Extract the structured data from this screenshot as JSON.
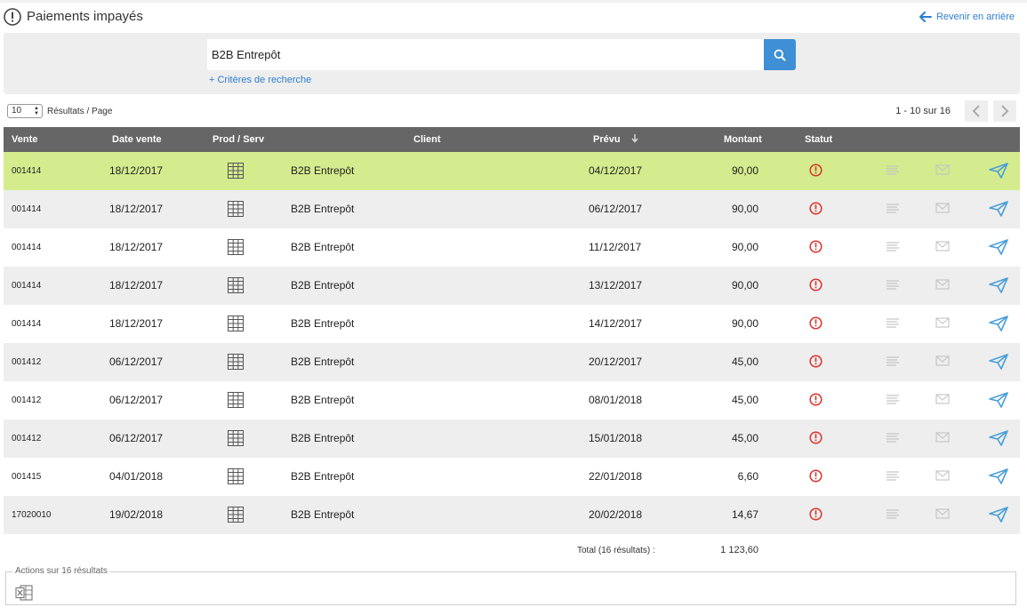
{
  "page": {
    "title": "Paiements impayés",
    "back_label": "Revenir en arrière"
  },
  "search": {
    "value": "B2B Entrepôt",
    "criteria_label": "+ Critères de recherche"
  },
  "pagination": {
    "page_size": "10",
    "page_size_label": "Résultats / Page",
    "range": "1 - 10 sur 16"
  },
  "table": {
    "headers": {
      "vente": "Vente",
      "date": "Date vente",
      "prod": "Prod / Serv",
      "client": "Client",
      "prevu": "Prévu",
      "montant": "Montant",
      "statut": "Statut"
    },
    "rows": [
      {
        "vente": "001414",
        "date": "18/12/2017",
        "client": "B2B Entrepôt",
        "prevu": "04/12/2017",
        "montant": "90,00"
      },
      {
        "vente": "001414",
        "date": "18/12/2017",
        "client": "B2B Entrepôt",
        "prevu": "06/12/2017",
        "montant": "90,00"
      },
      {
        "vente": "001414",
        "date": "18/12/2017",
        "client": "B2B Entrepôt",
        "prevu": "11/12/2017",
        "montant": "90,00"
      },
      {
        "vente": "001414",
        "date": "18/12/2017",
        "client": "B2B Entrepôt",
        "prevu": "13/12/2017",
        "montant": "90,00"
      },
      {
        "vente": "001414",
        "date": "18/12/2017",
        "client": "B2B Entrepôt",
        "prevu": "14/12/2017",
        "montant": "90,00"
      },
      {
        "vente": "001412",
        "date": "06/12/2017",
        "client": "B2B Entrepôt",
        "prevu": "20/12/2017",
        "montant": "45,00"
      },
      {
        "vente": "001412",
        "date": "06/12/2017",
        "client": "B2B Entrepôt",
        "prevu": "08/01/2018",
        "montant": "45,00"
      },
      {
        "vente": "001412",
        "date": "06/12/2017",
        "client": "B2B Entrepôt",
        "prevu": "15/01/2018",
        "montant": "45,00"
      },
      {
        "vente": "001415",
        "date": "04/01/2018",
        "client": "B2B Entrepôt",
        "prevu": "22/01/2018",
        "montant": "6,60"
      },
      {
        "vente": "17020010",
        "date": "19/02/2018",
        "client": "B2B Entrepôt",
        "prevu": "20/02/2018",
        "montant": "14,67"
      }
    ],
    "total_label": "Total (16 résultats) :",
    "total_value": "1 123,60"
  },
  "actions": {
    "legend": "Actions sur 16 résultats"
  },
  "colors": {
    "accent": "#3e8fd6",
    "header_bg": "#666666",
    "highlight_row": "#d4ec8e",
    "status_red": "#d9322b",
    "send_blue": "#4a9fd8"
  }
}
